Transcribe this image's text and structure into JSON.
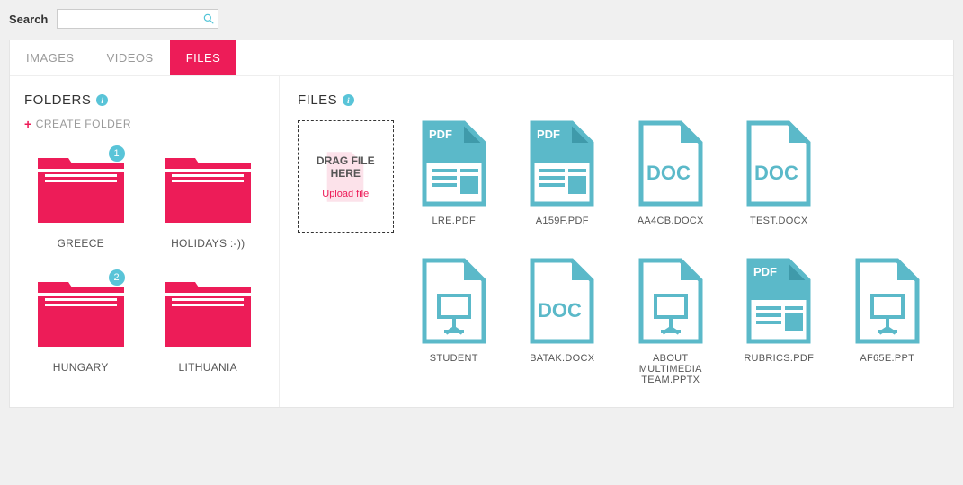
{
  "search": {
    "label": "Search",
    "value": ""
  },
  "tabs": [
    {
      "label": "IMAGES",
      "active": false
    },
    {
      "label": "VIDEOS",
      "active": false
    },
    {
      "label": "FILES",
      "active": true
    }
  ],
  "sidebar": {
    "title": "FOLDERS",
    "create_label": "CREATE FOLDER",
    "folders": [
      {
        "name": "GREECE",
        "badge": "1"
      },
      {
        "name": "HOLIDAYS :-))",
        "badge": null
      },
      {
        "name": "HUNGARY",
        "badge": "2"
      },
      {
        "name": "LITHUANIA",
        "badge": null
      }
    ]
  },
  "files_section": {
    "title": "FILES",
    "upload": {
      "drag_text": "DRAG FILE HERE",
      "link_text": "Upload file"
    },
    "files": [
      {
        "name": "LRE.PDF",
        "type": "pdf"
      },
      {
        "name": "A159F.PDF",
        "type": "pdf"
      },
      {
        "name": "AA4CB.DOCX",
        "type": "doc"
      },
      {
        "name": "TEST.DOCX",
        "type": "doc"
      },
      {
        "name": "STUDENT",
        "type": "ppt"
      },
      {
        "name": "BATAK.DOCX",
        "type": "doc"
      },
      {
        "name": "ABOUT MULTIMEDIA TEAM.PPTX",
        "type": "ppt"
      },
      {
        "name": "RUBRICS.PDF",
        "type": "pdf"
      },
      {
        "name": "AF65E.PPT",
        "type": "ppt"
      }
    ]
  },
  "colors": {
    "accent_pink": "#ed1c58",
    "accent_teal": "#5bb9c9"
  }
}
